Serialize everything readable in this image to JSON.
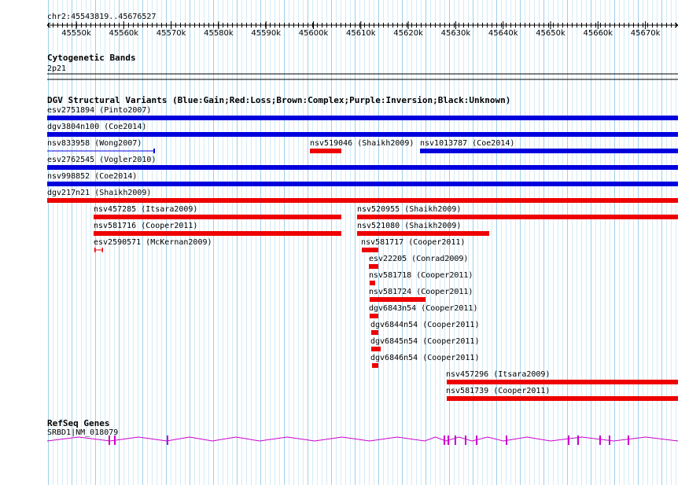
{
  "browser": {
    "position": "chr2:45543819..45676527",
    "start": 45543819,
    "end": 45676527,
    "ruler_ticks": [
      "45550k",
      "45560k",
      "45570k",
      "45580k",
      "45590k",
      "45600k",
      "45610k",
      "45620k",
      "45630k",
      "45640k",
      "45650k",
      "45660k",
      "45670k"
    ]
  },
  "cyto": {
    "title": "Cytogenetic Bands",
    "band": "2p21"
  },
  "dgv": {
    "title": "DGV Structural Variants (Blue:Gain;Red:Loss;Brown:Complex;Purple:Inversion;Black:Unknown)",
    "colors": {
      "gain": "#0000dd",
      "loss": "#ee0000"
    },
    "features": [
      {
        "label": "esv2751894 (Pinto2007)",
        "type": "gain"
      },
      {
        "label": "dgv3804n100 (Coe2014)",
        "type": "gain"
      },
      {
        "label": "nsv833958 (Wong2007)",
        "type": "gain"
      },
      {
        "label": "nsv519046 (Shaikh2009)",
        "type": "loss"
      },
      {
        "label": "nsv1013787 (Coe2014)",
        "type": "gain"
      },
      {
        "label": "esv2762545 (Vogler2010)",
        "type": "gain"
      },
      {
        "label": "nsv998852 (Coe2014)",
        "type": "gain"
      },
      {
        "label": "dgv217n21 (Shaikh2009)",
        "type": "loss"
      },
      {
        "label": "nsv457285 (Itsara2009)",
        "type": "loss"
      },
      {
        "label": "nsv520955 (Shaikh2009)",
        "type": "loss"
      },
      {
        "label": "nsv581716 (Cooper2011)",
        "type": "loss"
      },
      {
        "label": "nsv521080 (Shaikh2009)",
        "type": "loss"
      },
      {
        "label": "esv2590571 (McKernan2009)",
        "type": "loss"
      },
      {
        "label": "nsv581717 (Cooper2011)",
        "type": "loss"
      },
      {
        "label": "esv22205 (Conrad2009)",
        "type": "loss"
      },
      {
        "label": "nsv581718 (Cooper2011)",
        "type": "loss"
      },
      {
        "label": "nsv581724 (Cooper2011)",
        "type": "loss"
      },
      {
        "label": "dgv6843n54 (Cooper2011)",
        "type": "loss"
      },
      {
        "label": "dgv6844n54 (Cooper2011)",
        "type": "loss"
      },
      {
        "label": "dgv6845n54 (Cooper2011)",
        "type": "loss"
      },
      {
        "label": "dgv6846n54 (Cooper2011)",
        "type": "loss"
      },
      {
        "label": "nsv457296 (Itsara2009)",
        "type": "loss"
      },
      {
        "label": "nsv581739 (Cooper2011)",
        "type": "loss"
      }
    ]
  },
  "refseq": {
    "title": "RefSeq Genes",
    "gene_label": "SRBD1|NM_018079",
    "color": "#cc00cc"
  }
}
